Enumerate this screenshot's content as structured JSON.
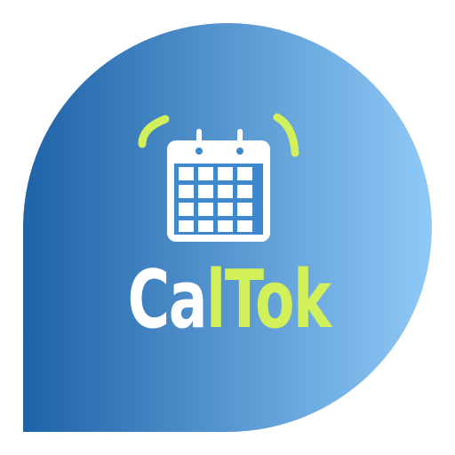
{
  "logo": {
    "name_part_1": "Ca",
    "name_part_2": "lTok",
    "colors": {
      "gradient_start": "#1e63a8",
      "gradient_end": "#8fc9f7",
      "accent": "#d2f05a",
      "icon": "#ffffff"
    },
    "icon": "calendar-icon"
  }
}
